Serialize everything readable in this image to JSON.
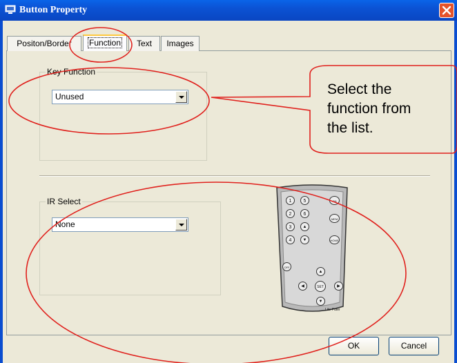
{
  "window": {
    "title": "Button Property",
    "close_icon": "close-icon"
  },
  "tabs": [
    {
      "label": "Positon/Border",
      "active": false
    },
    {
      "label": "Function",
      "active": true
    },
    {
      "label": "Text",
      "active": false
    },
    {
      "label": "Images",
      "active": false
    }
  ],
  "key_function": {
    "group_label": "Key Function",
    "selected": "Unused"
  },
  "ir_select": {
    "group_label": "IR Select",
    "selected": "None"
  },
  "callout": {
    "text_lines": [
      "Select the",
      "function from",
      "the list."
    ]
  },
  "remote": {
    "brand": "Lite-Puter",
    "number_keys": [
      "1",
      "2",
      "3",
      "4",
      "5",
      "6"
    ],
    "side_keys": [
      "ON",
      "MEM",
      "HOME"
    ],
    "off_key": "OFF",
    "set_key": "SET"
  },
  "buttons": {
    "ok": "OK",
    "cancel": "Cancel"
  },
  "colors": {
    "annotation_red": "#e0201c",
    "title_blue": "#0a55d8",
    "face": "#ece9d8"
  }
}
